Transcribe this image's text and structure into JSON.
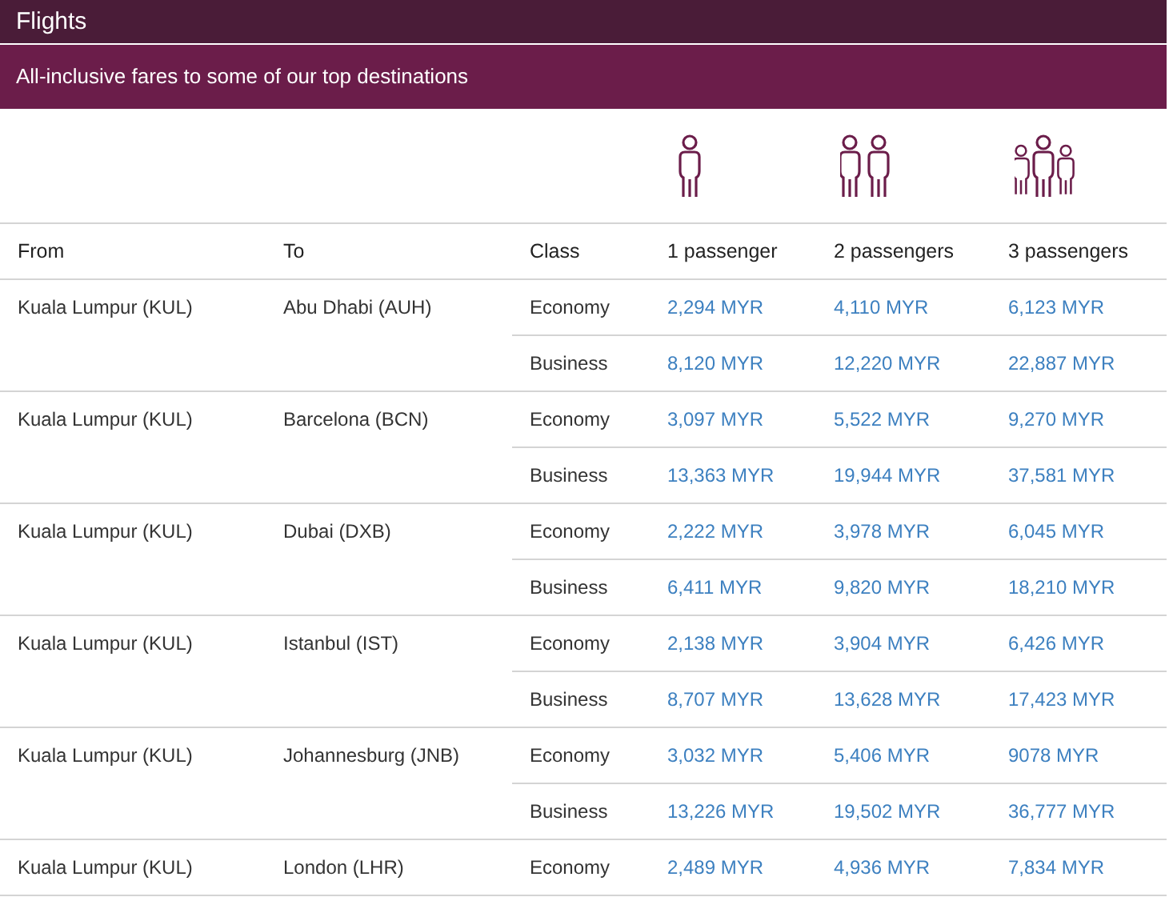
{
  "title": "Flights",
  "subtitle": "All-inclusive fares to some of our top destinations",
  "columns": [
    {
      "label": "From"
    },
    {
      "label": "To"
    },
    {
      "label": "Class"
    },
    {
      "label": "1 passenger",
      "kind": "single"
    },
    {
      "label": "2 passengers",
      "kind": "pair"
    },
    {
      "label": "3 passengers",
      "kind": "group"
    }
  ],
  "routes": [
    {
      "from": "Kuala Lumpur (KUL)",
      "to": "Abu Dhabi (AUH)",
      "fares": [
        {
          "class": "Economy",
          "prices": [
            "2,294 MYR",
            "4,110 MYR",
            "6,123 MYR"
          ]
        },
        {
          "class": "Business",
          "prices": [
            "8,120 MYR",
            "12,220 MYR",
            "22,887 MYR"
          ]
        }
      ]
    },
    {
      "from": "Kuala Lumpur (KUL)",
      "to": "Barcelona (BCN)",
      "fares": [
        {
          "class": "Economy",
          "prices": [
            "3,097 MYR",
            "5,522 MYR",
            "9,270 MYR"
          ]
        },
        {
          "class": "Business",
          "prices": [
            "13,363 MYR",
            "19,944 MYR",
            "37,581 MYR"
          ]
        }
      ]
    },
    {
      "from": "Kuala Lumpur (KUL)",
      "to": "Dubai (DXB)",
      "fares": [
        {
          "class": "Economy",
          "prices": [
            "2,222 MYR",
            "3,978 MYR",
            "6,045 MYR"
          ]
        },
        {
          "class": "Business",
          "prices": [
            "6,411 MYR",
            "9,820 MYR",
            "18,210 MYR"
          ]
        }
      ]
    },
    {
      "from": "Kuala Lumpur (KUL)",
      "to": "Istanbul (IST)",
      "fares": [
        {
          "class": "Economy",
          "prices": [
            "2,138 MYR",
            "3,904 MYR",
            "6,426 MYR"
          ]
        },
        {
          "class": "Business",
          "prices": [
            "8,707 MYR",
            "13,628 MYR",
            "17,423 MYR"
          ]
        }
      ]
    },
    {
      "from": "Kuala Lumpur (KUL)",
      "to": "Johannesburg (JNB)",
      "fares": [
        {
          "class": "Economy",
          "prices": [
            "3,032 MYR",
            "5,406 MYR",
            "9078 MYR"
          ]
        },
        {
          "class": "Business",
          "prices": [
            "13,226 MYR",
            "19,502 MYR",
            "36,777 MYR"
          ]
        }
      ]
    },
    {
      "from": "Kuala Lumpur (KUL)",
      "to": "London (LHR)",
      "fares": [
        {
          "class": "Economy",
          "prices": [
            "2,489 MYR",
            "4,936 MYR",
            "7,834 MYR"
          ]
        }
      ]
    }
  ]
}
